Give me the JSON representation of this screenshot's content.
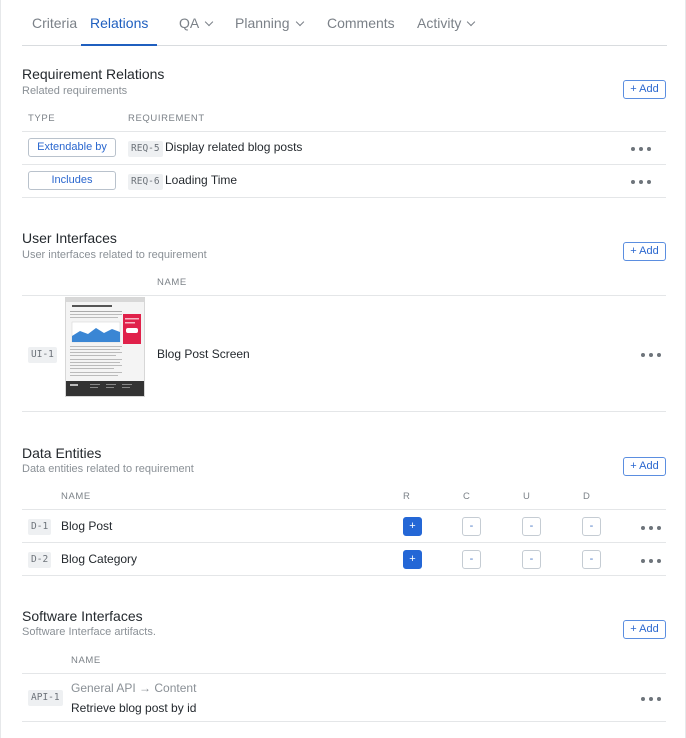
{
  "tabs": [
    {
      "label": "Criteria",
      "active": false,
      "dropdown": false
    },
    {
      "label": "Relations",
      "active": true,
      "dropdown": false
    },
    {
      "label": "QA",
      "active": false,
      "dropdown": true
    },
    {
      "label": "Planning",
      "active": false,
      "dropdown": true
    },
    {
      "label": "Comments",
      "active": false,
      "dropdown": false
    },
    {
      "label": "Activity",
      "active": false,
      "dropdown": true
    }
  ],
  "requirement_relations": {
    "title": "Requirement Relations",
    "subtitle": "Related requirements",
    "add_label": "+ Add",
    "col_type": "TYPE",
    "col_requirement": "REQUIREMENT",
    "rows": [
      {
        "type": "Extendable by",
        "id": "REQ-5",
        "name": "Display related blog posts"
      },
      {
        "type": "Includes",
        "id": "REQ-6",
        "name": "Loading Time"
      }
    ]
  },
  "user_interfaces": {
    "title": "User Interfaces",
    "subtitle": "User interfaces related to requirement",
    "add_label": "+ Add",
    "col_name": "NAME",
    "rows": [
      {
        "id": "UI-1",
        "name": "Blog Post Screen"
      }
    ]
  },
  "data_entities": {
    "title": "Data Entities",
    "subtitle": "Data entities related to requirement",
    "add_label": "+ Add",
    "col_name": "NAME",
    "col_r": "R",
    "col_c": "C",
    "col_u": "U",
    "col_d": "D",
    "rows": [
      {
        "id": "D-1",
        "name": "Blog Post",
        "r": "+",
        "c": "-",
        "u": "-",
        "d": "-"
      },
      {
        "id": "D-2",
        "name": "Blog Category",
        "r": "+",
        "c": "-",
        "u": "-",
        "d": "-"
      }
    ]
  },
  "software_interfaces": {
    "title": "Software Interfaces",
    "subtitle": "Software Interface artifacts.",
    "add_label": "+ Add",
    "col_name": "NAME",
    "rows": [
      {
        "id": "API-1",
        "path": "General API → Content",
        "name": "Retrieve blog post by id"
      }
    ]
  },
  "colors": {
    "accent": "#1f5fbf",
    "crud_active": "#2467d6",
    "thumbnail_highlight": "#e0214a",
    "thumbnail_chart": "#3a86d4"
  }
}
